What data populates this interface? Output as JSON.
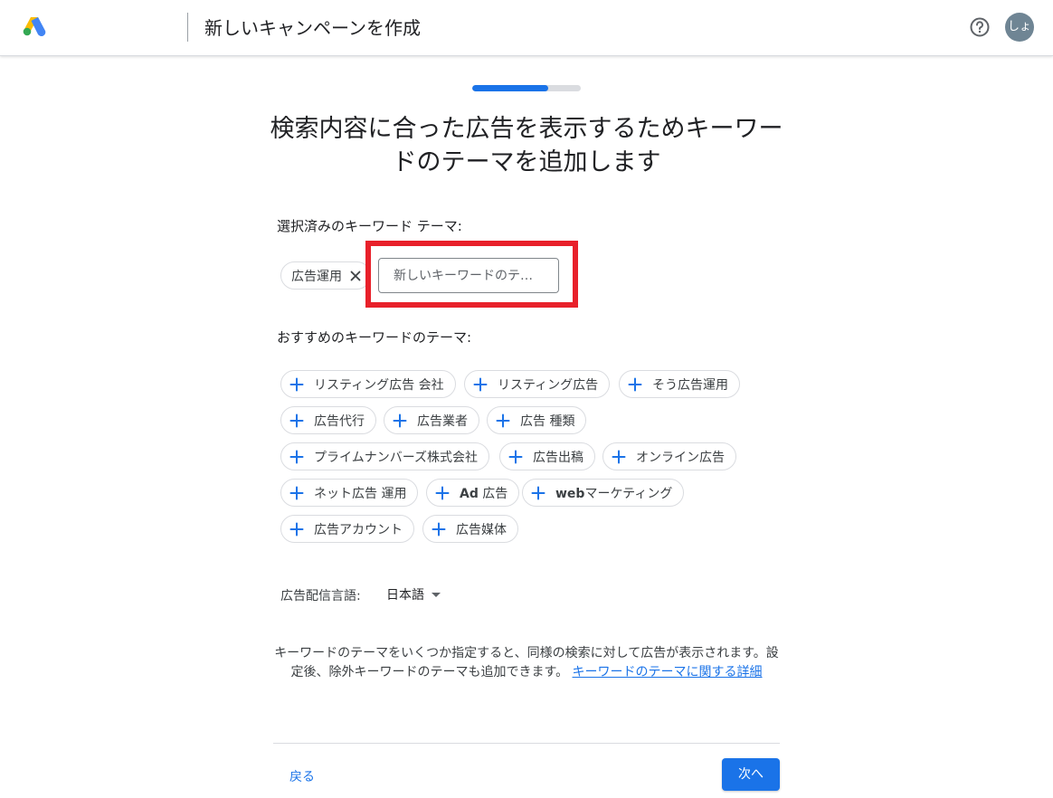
{
  "header": {
    "title": "新しいキャンペーンを作成",
    "avatar_text": "しょ",
    "icons": [
      "google-ads-logo",
      "help-icon"
    ]
  },
  "progress": {
    "fraction": 0.7
  },
  "main": {
    "heading": "検索内容に合った広告を表示するためキーワードのテーマを追加します",
    "selected_label": "選択済みのキーワード テーマ:",
    "selected_chips": [
      {
        "label": "広告運用"
      }
    ],
    "new_keyword_placeholder": "新しいキーワードのテー...",
    "recommended_label": "おすすめのキーワードのテーマ:",
    "recommended_chips": [
      {
        "label": "リスティング広告 会社"
      },
      {
        "label": "リスティング広告"
      },
      {
        "label": "そう広告運用"
      },
      {
        "label": "広告代行"
      },
      {
        "label": "広告業者"
      },
      {
        "label": "広告 種類"
      },
      {
        "label": "プライムナンバーズ株式会社"
      },
      {
        "label": "広告出稿"
      },
      {
        "label": "オンライン広告"
      },
      {
        "label": "ネット広告 運用"
      },
      {
        "bold": "Ad",
        "label": " 広告"
      },
      {
        "bold": "web",
        "label": "マーケティング"
      },
      {
        "label": "広告アカウント"
      },
      {
        "label": "広告媒体"
      }
    ],
    "language_label": "広告配信言語:",
    "language_value": "日本語",
    "info_text": "キーワードのテーマをいくつか指定すると、同様の検索に対して広告が表示されます。設定後、除外キーワードのテーマも追加できます。",
    "info_link": "キーワードのテーマに関する詳細"
  },
  "footer": {
    "back_label": "戻る",
    "next_label": "次へ"
  },
  "colors": {
    "accent": "#1a73e8",
    "highlight": "#e8202a",
    "border": "#dadce0"
  }
}
